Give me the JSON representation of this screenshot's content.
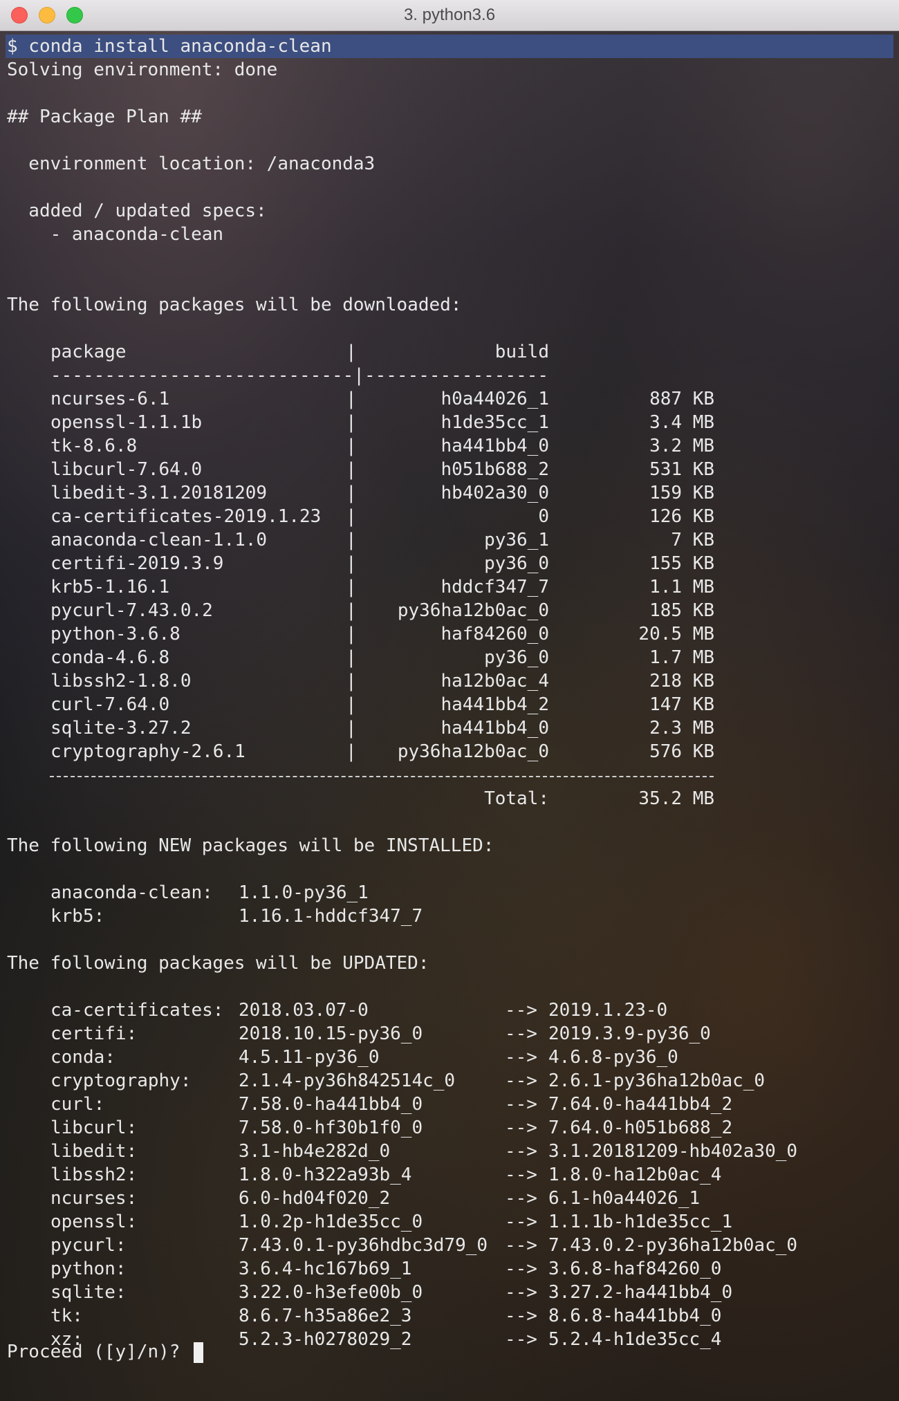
{
  "window": {
    "title": "3. python3.6"
  },
  "terminal": {
    "command": "$ conda install anaconda-clean",
    "solving": "Solving environment: done",
    "plan_header": "## Package Plan ##",
    "environment_location": "  environment location: /anaconda3",
    "specs_header": "  added / updated specs:",
    "spec_item": "    - anaconda-clean",
    "downloaded_header": "The following packages will be downloaded:",
    "table": {
      "col_package": "package",
      "col_build": "build",
      "separator": "----------------------------|-----------------",
      "rows": [
        {
          "package": "ncurses-6.1",
          "build": "h0a44026_1",
          "size": "887 KB"
        },
        {
          "package": "openssl-1.1.1b",
          "build": "h1de35cc_1",
          "size": "3.4 MB"
        },
        {
          "package": "tk-8.6.8",
          "build": "ha441bb4_0",
          "size": "3.2 MB"
        },
        {
          "package": "libcurl-7.64.0",
          "build": "h051b688_2",
          "size": "531 KB"
        },
        {
          "package": "libedit-3.1.20181209",
          "build": "hb402a30_0",
          "size": "159 KB"
        },
        {
          "package": "ca-certificates-2019.1.23",
          "build": "0",
          "size": "126 KB"
        },
        {
          "package": "anaconda-clean-1.1.0",
          "build": "py36_1",
          "size": "7 KB"
        },
        {
          "package": "certifi-2019.3.9",
          "build": "py36_0",
          "size": "155 KB"
        },
        {
          "package": "krb5-1.16.1",
          "build": "hddcf347_7",
          "size": "1.1 MB"
        },
        {
          "package": "pycurl-7.43.0.2",
          "build": "py36ha12b0ac_0",
          "size": "185 KB"
        },
        {
          "package": "python-3.6.8",
          "build": "haf84260_0",
          "size": "20.5 MB"
        },
        {
          "package": "conda-4.6.8",
          "build": "py36_0",
          "size": "1.7 MB"
        },
        {
          "package": "libssh2-1.8.0",
          "build": "ha12b0ac_4",
          "size": "218 KB"
        },
        {
          "package": "curl-7.64.0",
          "build": "ha441bb4_2",
          "size": "147 KB"
        },
        {
          "package": "sqlite-3.27.2",
          "build": "ha441bb4_0",
          "size": "2.3 MB"
        },
        {
          "package": "cryptography-2.6.1",
          "build": "py36ha12b0ac_0",
          "size": "576 KB"
        }
      ],
      "total_label": "Total:",
      "total_value": "35.2 MB"
    },
    "new_header": "The following NEW packages will be INSTALLED:",
    "new_packages": [
      {
        "name": "anaconda-clean:",
        "version": "1.1.0-py36_1"
      },
      {
        "name": "krb5:",
        "version": "1.16.1-hddcf347_7"
      }
    ],
    "updated_header": "The following packages will be UPDATED:",
    "updated_packages": [
      {
        "name": "ca-certificates:",
        "from": "2018.03.07-0",
        "arrow": "-->",
        "to": "2019.1.23-0"
      },
      {
        "name": "certifi:",
        "from": "2018.10.15-py36_0",
        "arrow": "-->",
        "to": "2019.3.9-py36_0"
      },
      {
        "name": "conda:",
        "from": "4.5.11-py36_0",
        "arrow": "-->",
        "to": "4.6.8-py36_0"
      },
      {
        "name": "cryptography:",
        "from": "2.1.4-py36h842514c_0",
        "arrow": "-->",
        "to": "2.6.1-py36ha12b0ac_0"
      },
      {
        "name": "curl:",
        "from": "7.58.0-ha441bb4_0",
        "arrow": "-->",
        "to": "7.64.0-ha441bb4_2"
      },
      {
        "name": "libcurl:",
        "from": "7.58.0-hf30b1f0_0",
        "arrow": "-->",
        "to": "7.64.0-h051b688_2"
      },
      {
        "name": "libedit:",
        "from": "3.1-hb4e282d_0",
        "arrow": "-->",
        "to": "3.1.20181209-hb402a30_0"
      },
      {
        "name": "libssh2:",
        "from": "1.8.0-h322a93b_4",
        "arrow": "-->",
        "to": "1.8.0-ha12b0ac_4"
      },
      {
        "name": "ncurses:",
        "from": "6.0-hd04f020_2",
        "arrow": "-->",
        "to": "6.1-h0a44026_1"
      },
      {
        "name": "openssl:",
        "from": "1.0.2p-h1de35cc_0",
        "arrow": "-->",
        "to": "1.1.1b-h1de35cc_1"
      },
      {
        "name": "pycurl:",
        "from": "7.43.0.1-py36hdbc3d79_0",
        "arrow": "-->",
        "to": "7.43.0.2-py36ha12b0ac_0"
      },
      {
        "name": "python:",
        "from": "3.6.4-hc167b69_1",
        "arrow": "-->",
        "to": "3.6.8-haf84260_0"
      },
      {
        "name": "sqlite:",
        "from": "3.22.0-h3efe00b_0",
        "arrow": "-->",
        "to": "3.27.2-ha441bb4_0"
      },
      {
        "name": "tk:",
        "from": "8.6.7-h35a86e2_3",
        "arrow": "-->",
        "to": "8.6.8-ha441bb4_0"
      },
      {
        "name": "xz:",
        "from": "5.2.3-h0278029_2",
        "arrow": "-->",
        "to": "5.2.4-h1de35cc_4"
      }
    ],
    "prompt": "Proceed ([y]/n)? "
  },
  "colors": {
    "selection": "#3d4f80",
    "text": "#e8e8e8",
    "close": "#fc605b",
    "minimize": "#fdbc40",
    "maximize": "#34c84a"
  }
}
